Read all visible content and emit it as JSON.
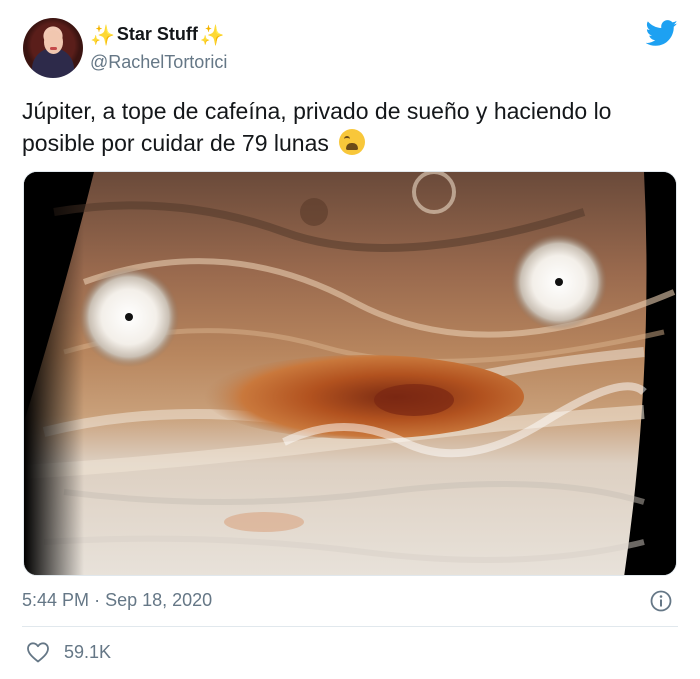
{
  "author": {
    "display_name": "Star Stuff",
    "sparkle_left": "✨",
    "sparkle_right": "✨",
    "handle": "@RachelTortorici"
  },
  "tweet": {
    "text_before_emoji": "Júpiter, a tope de cafeína, privado de sueño y haciendo lo posible por cuidar de 79 lunas",
    "emoji": "weary-face"
  },
  "meta": {
    "time": "5:44 PM",
    "separator": "·",
    "date": "Sep 18, 2020"
  },
  "engagement": {
    "likes": "59.1K"
  },
  "icons": {
    "brand": "twitter-bird-icon",
    "info": "info-icon",
    "like": "heart-icon"
  },
  "colors": {
    "brand_blue": "#1da1f2",
    "muted_text": "#657786",
    "text": "#14171a"
  }
}
